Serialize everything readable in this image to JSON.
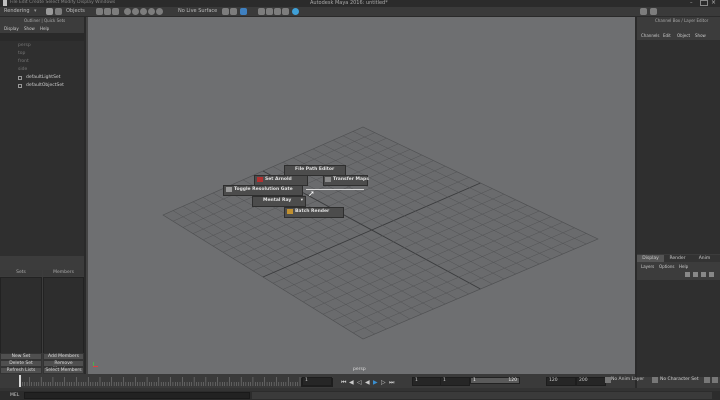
{
  "window": {
    "title": "Autodesk Maya 2016: untitled*",
    "menu_left": "Rendering",
    "objects_label": "Objects",
    "no_live_surface": "No Live Surface"
  },
  "outliner": {
    "title": "Outliner | Quick Sets",
    "menu": [
      "Display",
      "Show",
      "Help"
    ],
    "items": [
      {
        "label": "persp",
        "dim": true
      },
      {
        "label": "top",
        "dim": true
      },
      {
        "label": "front",
        "dim": true
      },
      {
        "label": "side",
        "dim": true
      },
      {
        "label": "defaultLightSet",
        "dim": false
      },
      {
        "label": "defaultObjectSet",
        "dim": false
      }
    ]
  },
  "sets_panel": {
    "col_sets": "Sets",
    "col_members": "Members",
    "buttons": {
      "new_set": "New Set",
      "delete_set": "Delete Set",
      "refresh_lists": "Refresh Lists",
      "add_members": "Add Members",
      "remove_members": "Remove Members",
      "select_members": "Select Members"
    }
  },
  "viewport": {
    "camera_label": "persp",
    "shelf_buttons": {
      "file_path_editor": "File Path Editor",
      "set_arnold": "Set Arnold",
      "transfer_maps": "Transfer Maps",
      "toggle_resolution_gate": "Toggle Resolution Gate",
      "mental_ray": "Mental Ray",
      "batch_render": "Batch Render"
    }
  },
  "channel_box": {
    "title": "Channel Box / Layer Editor",
    "menu": [
      "Channels",
      "Edit",
      "Object",
      "Show"
    ]
  },
  "layer_editor": {
    "tabs": [
      "Display",
      "Render",
      "Anim"
    ],
    "menu": [
      "Layers",
      "Options",
      "Help"
    ]
  },
  "timeline": {
    "ticks": [
      "1",
      "5",
      "10",
      "15",
      "20",
      "25",
      "30",
      "35",
      "40",
      "45",
      "50",
      "55",
      "60",
      "65",
      "70",
      "75",
      "80",
      "85",
      "90",
      "95",
      "100",
      "105",
      "110",
      "115",
      "120"
    ],
    "current_frame": "1"
  },
  "range": {
    "start": "1",
    "anim_start": "1",
    "slider_start": "1",
    "slider_end": "120",
    "anim_end": "120",
    "end": "200",
    "anim_layer": "No Anim Layer",
    "character_set": "No Character Set"
  },
  "command_line": {
    "label": "MEL"
  }
}
